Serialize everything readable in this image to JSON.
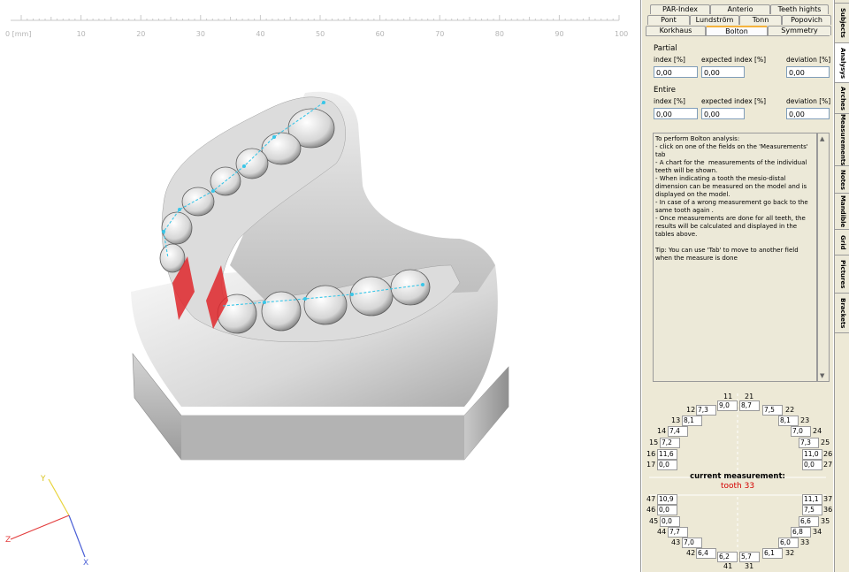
{
  "ruler": {
    "start_label": "0 [mm]",
    "labels": [
      "10",
      "20",
      "30",
      "40",
      "50",
      "60",
      "70",
      "80",
      "90",
      "100"
    ]
  },
  "axes": {
    "y": "Y",
    "z": "Z",
    "x": "X"
  },
  "tabs": {
    "row1": [
      "PAR-Index",
      "Anterio",
      "Teeth hights"
    ],
    "row2": [
      "Pont",
      "Lundström",
      "Tonn",
      "Popovich"
    ],
    "row3": [
      "Korkhaus",
      "Bolton",
      "Symmetry"
    ],
    "active": "Bolton"
  },
  "vertical_tabs": [
    "Subjects",
    "Analysys",
    "Arches",
    "Measurements",
    "Notes",
    "Mandible",
    "Grid",
    "Pictures",
    "Brackets"
  ],
  "partial": {
    "title": "Partial",
    "index_label": "index [%]",
    "expected_label": "expected index [%]",
    "deviation_label": "deviation [%]",
    "index": "0,00",
    "expected": "0,00",
    "deviation": "0,00"
  },
  "entire": {
    "title": "Entire",
    "index_label": "index [%]",
    "expected_label": "expected index [%]",
    "deviation_label": "deviation [%]",
    "index": "0,00",
    "expected": "0,00",
    "deviation": "0,00"
  },
  "info_text": "To perform Bolton analysis:\n- click on one of the fields on the 'Measurements' tab\n- A chart for the  measurements of the individual teeth will be shown.\n- When indicating a tooth the mesio-distal dimension can be measured on the model and is displayed on the model.\n- In case of a wrong measurement go back to the same tooth again .\n- Once measurements are done for all teeth, the results will be calculated and displayed in the tables above.\n\nTip: You can use 'Tab' to move to another field when the measure is done",
  "current_measurement": {
    "label": "current measurement:",
    "value": "tooth 33"
  },
  "upper_teeth": {
    "t11": {
      "n": "11",
      "v": "9,0"
    },
    "t21": {
      "n": "21",
      "v": "8,7"
    },
    "t12": {
      "n": "12",
      "v": "7,3"
    },
    "t22": {
      "n": "22",
      "v": "7,5"
    },
    "t13": {
      "n": "13",
      "v": "8,1"
    },
    "t23": {
      "n": "23",
      "v": "8,1"
    },
    "t14": {
      "n": "14",
      "v": "7,4"
    },
    "t24": {
      "n": "24",
      "v": "7,0"
    },
    "t15": {
      "n": "15",
      "v": "7,2"
    },
    "t25": {
      "n": "25",
      "v": "7,3"
    },
    "t16": {
      "n": "16",
      "v": "11,6"
    },
    "t26": {
      "n": "26",
      "v": "11,0"
    },
    "t17": {
      "n": "17",
      "v": "0,0"
    },
    "t27": {
      "n": "27",
      "v": "0,0"
    }
  },
  "lower_teeth": {
    "t47": {
      "n": "47",
      "v": "10,9"
    },
    "t37": {
      "n": "37",
      "v": "11,1"
    },
    "t46": {
      "n": "46",
      "v": "0,0"
    },
    "t36": {
      "n": "36",
      "v": "7,5"
    },
    "t45": {
      "n": "45",
      "v": "0,0"
    },
    "t35": {
      "n": "35",
      "v": "6,6"
    },
    "t44": {
      "n": "44",
      "v": "7,7"
    },
    "t34": {
      "n": "34",
      "v": "6,8"
    },
    "t43": {
      "n": "43",
      "v": "7,0"
    },
    "t33": {
      "n": "33",
      "v": "6,0"
    },
    "t42": {
      "n": "42",
      "v": "6,4"
    },
    "t32": {
      "n": "32",
      "v": "6,1"
    },
    "t41": {
      "n": "41",
      "v": "6,2"
    },
    "t31": {
      "n": "31",
      "v": "5,7"
    }
  },
  "colors": {
    "panel": "#ede9d6",
    "tab_active_accent": "#f5b33d",
    "measure_marker": "#e0282d",
    "arch_line": "#39c6e8",
    "current_tooth": "#d40000"
  }
}
